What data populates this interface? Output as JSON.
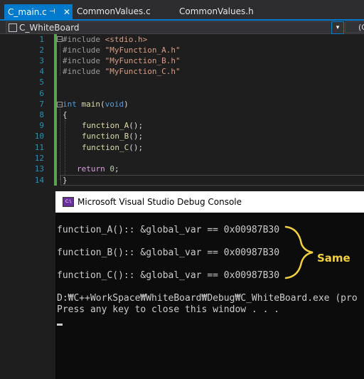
{
  "tabs": [
    {
      "label": "C_main.c",
      "pin": "⊣",
      "close": "✕",
      "active": true
    },
    {
      "label": "CommonValues.c"
    },
    {
      "label": "CommonValues.h"
    }
  ],
  "navbar": {
    "scope": "C_WhiteBoard",
    "dropdown_glyph": "▾",
    "right": "(G"
  },
  "editor": {
    "line_numbers": [
      "1",
      "2",
      "3",
      "4",
      "5",
      "6",
      "7",
      "8",
      "9",
      "10",
      "11",
      "12",
      "13",
      "14"
    ],
    "code": {
      "l1_pp": "#include",
      "l1_str": "<stdio.h>",
      "l2_pp": "#include",
      "l2_str": "\"MyFunction_A.h\"",
      "l3_pp": "#include",
      "l3_str": "\"MyFunction_B.h\"",
      "l4_pp": "#include",
      "l4_str": "\"MyFunction_C.h\"",
      "l7_kw": "int",
      "l7_fn": "main",
      "l7_paren_open": "(",
      "l7_void": "void",
      "l7_paren_close": ")",
      "l8": "{",
      "l9": "function_A",
      "l10": "function_B",
      "l11": "function_C",
      "call_tail": "();",
      "l13_kw": "return",
      "l13_num": "0",
      "l13_tail": ";",
      "l14": "}"
    }
  },
  "console": {
    "title": "Microsoft Visual Studio Debug Console",
    "icon": "C:\\",
    "lines": [
      "function_A():: &global_var == 0x00987B30",
      "function_B():: &global_var == 0x00987B30",
      "function_C():: &global_var == 0x00987B30",
      "D:₩C++WorkSpace₩WhiteBoard₩Debug₩C_WhiteBoard.exe (pro",
      "Press any key to close this window . . ."
    ],
    "annotation": "Same"
  },
  "colors": {
    "accent": "#007acc",
    "annotation": "#f3d03e"
  }
}
